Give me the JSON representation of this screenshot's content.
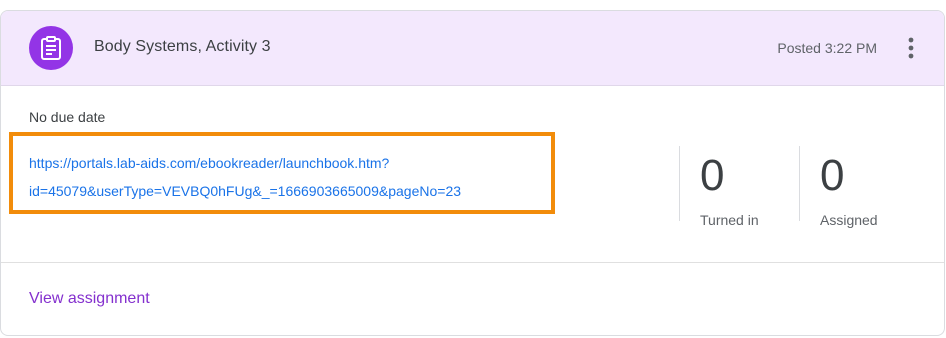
{
  "assignment": {
    "title": "Body Systems, Activity 3",
    "posted": "Posted 3:22 PM",
    "due": "No due date",
    "link_line1": "https://portals.lab-aids.com/ebookreader/launchbook.htm?",
    "link_line2": "id=45079&userType=VEVBQ0hFUg&_=1666903665009&pageNo=23",
    "icon": "assignment-clipboard-icon"
  },
  "stats": {
    "turned_in": {
      "value": "0",
      "label": "Turned in"
    },
    "assigned": {
      "value": "0",
      "label": "Assigned"
    }
  },
  "footer": {
    "view_label": "View assignment"
  },
  "colors": {
    "header_bg": "#f3e8fd",
    "icon_bg": "#9334e6",
    "link": "#1a73e8",
    "highlight_border": "#f28c0a",
    "view_link": "#8430ce"
  }
}
